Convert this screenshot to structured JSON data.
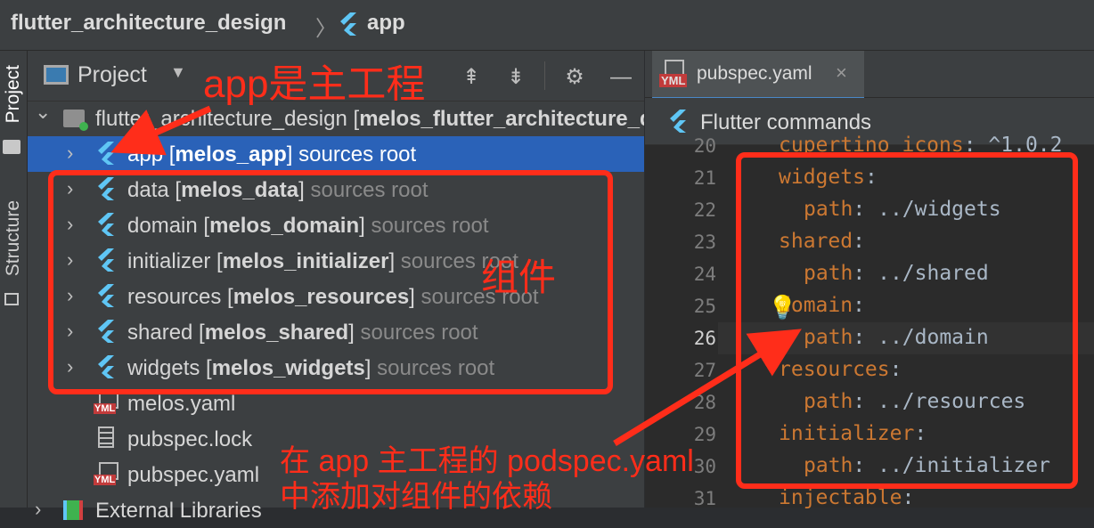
{
  "breadcrumb": {
    "root": "flutter_architecture_design",
    "current": "app"
  },
  "left_strip": {
    "project_tab": "Project",
    "structure_tab": "Structure"
  },
  "project_panel": {
    "view_label": "Project",
    "tree": [
      {
        "name": "flutter_architecture_design",
        "module": "melos_flutter_architecture_design",
        "suffix": "",
        "icon": "module-folder-icon",
        "indent": 0,
        "expanded": true,
        "selected": false
      },
      {
        "name": "app",
        "module": "melos_app",
        "suffix": "sources root",
        "icon": "flutter-icon",
        "indent": 1,
        "expanded": false,
        "selected": true
      },
      {
        "name": "data",
        "module": "melos_data",
        "suffix": "sources root",
        "icon": "flutter-icon",
        "indent": 1,
        "expanded": false,
        "selected": false
      },
      {
        "name": "domain",
        "module": "melos_domain",
        "suffix": "sources root",
        "icon": "flutter-icon",
        "indent": 1,
        "expanded": false,
        "selected": false
      },
      {
        "name": "initializer",
        "module": "melos_initializer",
        "suffix": "sources root",
        "icon": "flutter-icon",
        "indent": 1,
        "expanded": false,
        "selected": false
      },
      {
        "name": "resources",
        "module": "melos_resources",
        "suffix": "sources root",
        "icon": "flutter-icon",
        "indent": 1,
        "expanded": false,
        "selected": false
      },
      {
        "name": "shared",
        "module": "melos_shared",
        "suffix": "sources root",
        "icon": "flutter-icon",
        "indent": 1,
        "expanded": false,
        "selected": false
      },
      {
        "name": "widgets",
        "module": "melos_widgets",
        "suffix": "sources root",
        "icon": "flutter-icon",
        "indent": 1,
        "expanded": false,
        "selected": false
      },
      {
        "name": "melos.yaml",
        "module": "",
        "suffix": "",
        "icon": "yaml-file-icon",
        "indent": 1,
        "expanded": null,
        "selected": false
      },
      {
        "name": "pubspec.lock",
        "module": "",
        "suffix": "",
        "icon": "text-file-icon",
        "indent": 1,
        "expanded": null,
        "selected": false
      },
      {
        "name": "pubspec.yaml",
        "module": "",
        "suffix": "",
        "icon": "yaml-file-icon",
        "indent": 1,
        "expanded": null,
        "selected": false
      },
      {
        "name": "External Libraries",
        "module": "",
        "suffix": "",
        "icon": "library-icon",
        "indent": 0,
        "expanded": false,
        "selected": false
      }
    ]
  },
  "editor": {
    "tab_label": "pubspec.yaml",
    "tab_icon_text": "YML",
    "commands_label": "Flutter commands",
    "current_line": 26,
    "lines": [
      {
        "num": "20",
        "key": "cupertino_icons",
        "sep": ": ",
        "value": "^1.0.2",
        "indent": 0
      },
      {
        "num": "21",
        "key": "widgets",
        "sep": ":",
        "value": "",
        "indent": 0
      },
      {
        "num": "22",
        "key": "path",
        "sep": ": ",
        "value": "../widgets",
        "indent": 1
      },
      {
        "num": "23",
        "key": "shared",
        "sep": ":",
        "value": "",
        "indent": 0
      },
      {
        "num": "24",
        "key": "path",
        "sep": ": ",
        "value": "../shared",
        "indent": 1
      },
      {
        "num": "25",
        "key": "domain",
        "sep": ":",
        "value": "",
        "indent": 0
      },
      {
        "num": "26",
        "key": "path",
        "sep": ": ",
        "value": "../domain",
        "indent": 1
      },
      {
        "num": "27",
        "key": "resources",
        "sep": ":",
        "value": "",
        "indent": 0
      },
      {
        "num": "28",
        "key": "path",
        "sep": ": ",
        "value": "../resources",
        "indent": 1
      },
      {
        "num": "29",
        "key": "initializer",
        "sep": ":",
        "value": "",
        "indent": 0
      },
      {
        "num": "30",
        "key": "path",
        "sep": ": ",
        "value": "../initializer",
        "indent": 1
      },
      {
        "num": "31",
        "key": "injectable",
        "sep": ":",
        "value": "",
        "indent": 0
      }
    ]
  },
  "annotations": {
    "app_main": "app是主工程",
    "components": "组件",
    "dependency_line1": "在 app 主工程的 podspec.yaml",
    "dependency_line2": "中添加对组件的依赖"
  },
  "colors": {
    "accent_red": "#ff2d1a",
    "selection": "#2a62b8",
    "yaml_key": "#cc7832",
    "yaml_value": "#a9b7c6",
    "flutter_blue": "#5fc6f5"
  }
}
